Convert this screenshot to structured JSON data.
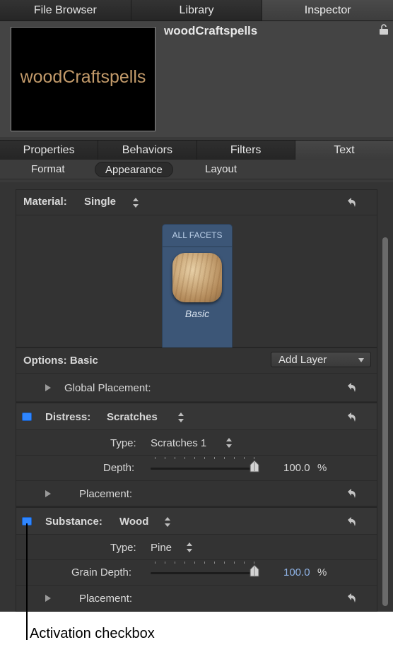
{
  "top_tabs": [
    {
      "label": "File Browser",
      "active": false
    },
    {
      "label": "Library",
      "active": false
    },
    {
      "label": "Inspector",
      "active": true
    }
  ],
  "preview": {
    "text": "woodCraftspells"
  },
  "object_name": "woodCraftspells",
  "section_tabs": [
    {
      "label": "Properties",
      "active": false
    },
    {
      "label": "Behaviors",
      "active": false
    },
    {
      "label": "Filters",
      "active": false
    },
    {
      "label": "Text",
      "active": true
    }
  ],
  "sub_tabs": [
    {
      "label": "Format",
      "active": false
    },
    {
      "label": "Appearance",
      "active": true
    },
    {
      "label": "Layout",
      "active": false
    }
  ],
  "material": {
    "label": "Material:",
    "value": "Single"
  },
  "facet": {
    "title": "ALL FACETS",
    "name": "Basic"
  },
  "options": {
    "label": "Options: Basic",
    "add_layer": "Add Layer",
    "global_placement": "Global Placement:"
  },
  "distress": {
    "label": "Distress:",
    "value": "Scratches",
    "enabled": true,
    "type_label": "Type:",
    "type_value": "Scratches 1",
    "depth_label": "Depth:",
    "depth_value": "100.0",
    "depth_unit": "%",
    "placement_label": "Placement:"
  },
  "substance": {
    "label": "Substance:",
    "value": "Wood",
    "enabled": true,
    "type_label": "Type:",
    "type_value": "Pine",
    "grain_label": "Grain Depth:",
    "grain_value": "100.0",
    "grain_unit": "%",
    "placement_label": "Placement:"
  },
  "caption": "Activation checkbox",
  "colors": {
    "accent": "#2f86ff",
    "facet_bg": "#3c5677",
    "value_blue": "#8fb3e6"
  }
}
